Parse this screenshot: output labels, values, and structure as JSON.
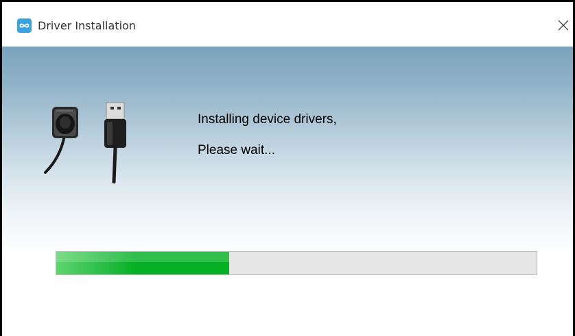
{
  "window": {
    "title": "Driver Installation",
    "app_icon": "infinity-icon",
    "close_icon": "close-icon"
  },
  "content": {
    "message_line1": "Installing device drivers,",
    "message_line2": "Please wait...",
    "graphic_icons": [
      "sensor-icon",
      "usb-plug-icon"
    ]
  },
  "progress": {
    "fraction": 0.36,
    "fill_color": "#06b025",
    "track_color": "#e6e6e6"
  },
  "colors": {
    "accent": "#3aa3dc",
    "banner_top": "#7aa3bc"
  }
}
